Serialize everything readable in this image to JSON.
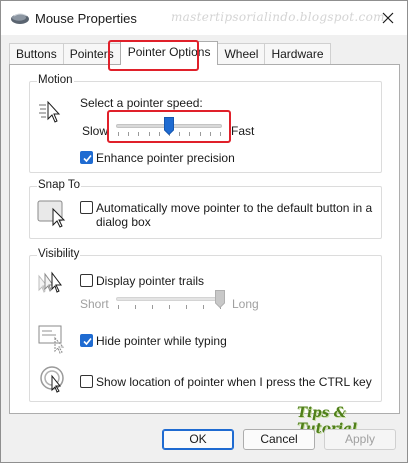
{
  "window": {
    "title": "Mouse Properties",
    "watermark": "mastertipsorialindo.blogspot.com"
  },
  "tabs": [
    {
      "label": "Buttons",
      "active": false
    },
    {
      "label": "Pointers",
      "active": false
    },
    {
      "label": "Pointer Options",
      "active": true
    },
    {
      "label": "Wheel",
      "active": false
    },
    {
      "label": "Hardware",
      "active": false
    }
  ],
  "motion": {
    "group_label": "Motion",
    "speed_label": "Select a pointer speed:",
    "slow_label": "Slow",
    "fast_label": "Fast",
    "speed_value": 6,
    "speed_max": 11,
    "enhance_label": "Enhance pointer precision",
    "enhance_checked": true
  },
  "snap": {
    "group_label": "Snap To",
    "auto_label_line1": "Automatically move pointer to the default button in a",
    "auto_label_line2": "dialog box",
    "auto_checked": false
  },
  "visibility": {
    "group_label": "Visibility",
    "trails_label": "Display pointer trails",
    "trails_checked": false,
    "short_label": "Short",
    "long_label": "Long",
    "trail_length_value": 6,
    "trail_length_max": 6,
    "hide_label": "Hide pointer while typing",
    "hide_checked": true,
    "ctrl_label": "Show location of pointer when I press the CTRL key",
    "ctrl_checked": false
  },
  "buttons": {
    "ok": "OK",
    "cancel": "Cancel",
    "apply": "Apply"
  },
  "logo_text": "Tips & Tutorial",
  "colors": {
    "accent": "#1f6bd1",
    "highlight": "#e0202a",
    "logo": "#4f7f1a"
  }
}
